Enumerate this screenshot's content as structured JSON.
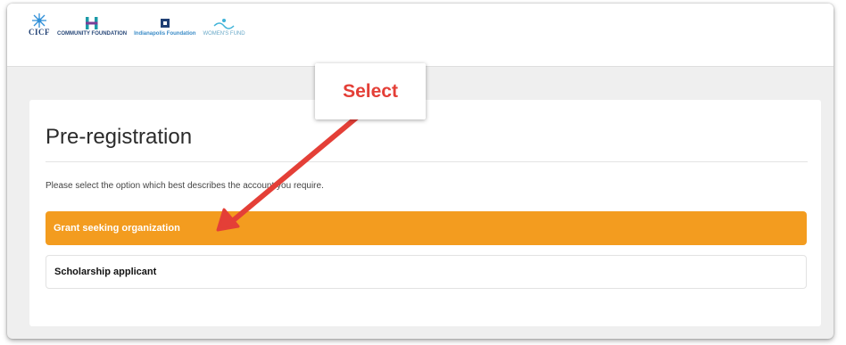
{
  "header": {
    "logos": [
      {
        "name": "cicf",
        "text": "CICF"
      },
      {
        "name": "hamilton-county-community-foundation",
        "text": "COMMUNITY FOUNDATION"
      },
      {
        "name": "indianapolis-foundation",
        "text": "Indianapolis Foundation"
      },
      {
        "name": "womens-fund",
        "text": "WOMEN'S FUND"
      }
    ]
  },
  "page": {
    "title": "Pre-registration",
    "instruction": "Please select the option which best describes the account you require.",
    "options": [
      {
        "label": "Grant seeking organization",
        "selected": true
      },
      {
        "label": "Scholarship applicant",
        "selected": false
      }
    ]
  },
  "annotation": {
    "callout_label": "Select",
    "callout_color": "#e43f37",
    "arrow_color": "#e43f37"
  },
  "colors": {
    "accent": "#f39c1f",
    "background": "#efefef",
    "card": "#ffffff"
  }
}
